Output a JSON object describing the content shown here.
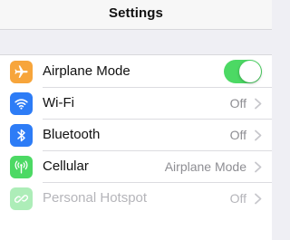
{
  "header": {
    "title": "Settings"
  },
  "rows": [
    {
      "label": "Airplane Mode",
      "icon": "airplane-icon",
      "icon_color": "#f7a53b",
      "control": "toggle",
      "toggle_on": true
    },
    {
      "label": "Wi-Fi",
      "icon": "wifi-icon",
      "icon_color": "#2d7cf6",
      "value": "Off"
    },
    {
      "label": "Bluetooth",
      "icon": "bluetooth-icon",
      "icon_color": "#2d7cf6",
      "value": "Off"
    },
    {
      "label": "Cellular",
      "icon": "cellular-icon",
      "icon_color": "#4cd964",
      "value": "Airplane Mode"
    },
    {
      "label": "Personal Hotspot",
      "icon": "hotspot-icon",
      "icon_color": "#4cd964",
      "value": "Off",
      "disabled": true
    }
  ],
  "colors": {
    "toggle_on": "#4cd964",
    "chevron": "#c7c7cc"
  }
}
